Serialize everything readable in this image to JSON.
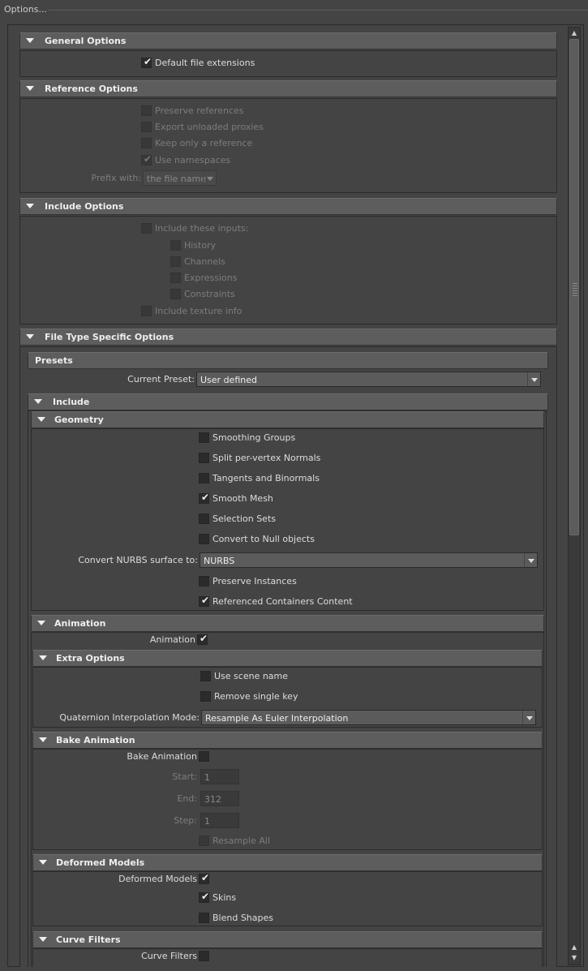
{
  "window": {
    "title": "Options..."
  },
  "general": {
    "header": "General Options",
    "default_ext": "Default file extensions"
  },
  "reference": {
    "header": "Reference Options",
    "preserve": "Preserve references",
    "export_unloaded": "Export unloaded proxies",
    "keep_only": "Keep only a reference",
    "use_namespaces": "Use namespaces",
    "prefix_label": "Prefix with:",
    "prefix_value": "the file name"
  },
  "include_opts": {
    "header": "Include Options",
    "include_inputs": "Include these inputs:",
    "history": "History",
    "channels": "Channels",
    "expressions": "Expressions",
    "constraints": "Constraints",
    "texture": "Include texture info"
  },
  "filetype": {
    "header": "File Type Specific Options"
  },
  "presets": {
    "header": "Presets",
    "current_label": "Current Preset:",
    "current_value": "User defined"
  },
  "include": {
    "header": "Include"
  },
  "geometry": {
    "header": "Geometry",
    "smoothing": "Smoothing Groups",
    "split": "Split per-vertex Normals",
    "tangents": "Tangents and Binormals",
    "smooth_mesh": "Smooth Mesh",
    "selection_sets": "Selection Sets",
    "convert_null": "Convert to Null objects",
    "nurbs_label": "Convert NURBS surface to:",
    "nurbs_value": "NURBS",
    "preserve_instances": "Preserve Instances",
    "referenced": "Referenced Containers Content"
  },
  "animation": {
    "header": "Animation",
    "label": "Animation"
  },
  "extra": {
    "header": "Extra Options",
    "use_scene": "Use scene name",
    "remove_single": "Remove single key",
    "quat_label": "Quaternion Interpolation Mode:",
    "quat_value": "Resample As Euler Interpolation"
  },
  "bake": {
    "header": "Bake Animation",
    "label": "Bake Animation",
    "start_label": "Start:",
    "start_value": "1",
    "end_label": "End:",
    "end_value": "312",
    "step_label": "Step:",
    "step_value": "1",
    "resample": "Resample All"
  },
  "deformed": {
    "header": "Deformed Models",
    "label": "Deformed Models",
    "skins": "Skins",
    "blend": "Blend Shapes"
  },
  "curve": {
    "header": "Curve Filters",
    "label": "Curve Filters"
  }
}
